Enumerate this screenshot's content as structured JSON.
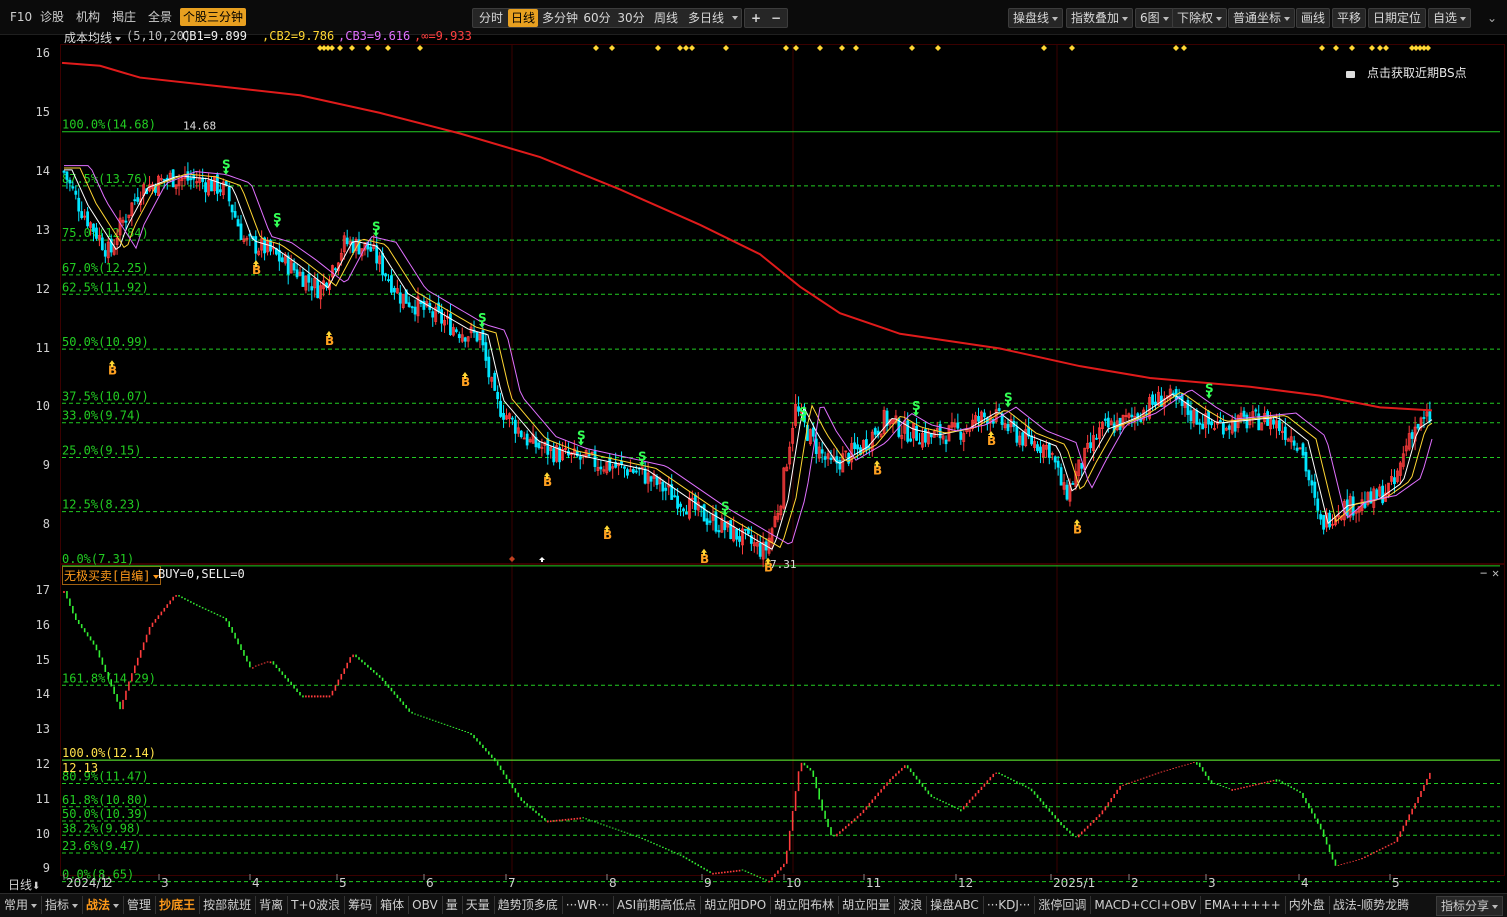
{
  "top_left": [
    {
      "label": "F10"
    },
    {
      "label": "诊股"
    },
    {
      "label": "机构"
    },
    {
      "label": "揭庄"
    },
    {
      "label": "全景"
    },
    {
      "label": "个股三分钟",
      "highlight": true
    }
  ],
  "periods": [
    "分时",
    "日线",
    "多分钟",
    "60分",
    "30分",
    "周线",
    "多日线"
  ],
  "active_period": "日线",
  "zoom_in": "+",
  "zoom_out": "−",
  "right_tools": [
    {
      "label": "操盘线",
      "dd": true
    },
    {
      "label": "指数叠加",
      "dd": true
    },
    {
      "label": "6图",
      "dd": true
    },
    {
      "label": "下除权",
      "dd": true
    },
    {
      "label": "普通坐标",
      "dd": true
    },
    {
      "label": "画线",
      "dd": false
    },
    {
      "label": "平移",
      "dd": false
    },
    {
      "label": "日期定位",
      "dd": false
    },
    {
      "label": "自选",
      "dd": true
    }
  ],
  "main": {
    "indicator_name": "成本均线",
    "params": "(5,10,20)",
    "cb1": "CB1=9.899",
    "cb2": ",CB2=9.786",
    "cb3": ",CB3=9.616",
    "cbinf": ",∞=9.933",
    "y_labels": [
      "16",
      "15",
      "14",
      "13",
      "12",
      "11",
      "10",
      "9",
      "8"
    ],
    "fib_levels": [
      {
        "label": "100.0%(14.68)",
        "value": 14.68,
        "solid": true
      },
      {
        "label": "87.5%(13.76)",
        "value": 13.76
      },
      {
        "label": "75.0%(12.84)",
        "value": 12.84
      },
      {
        "label": "67.0%(12.25)",
        "value": 12.25
      },
      {
        "label": "62.5%(11.92)",
        "value": 11.92
      },
      {
        "label": "50.0%(10.99)",
        "value": 10.99
      },
      {
        "label": "37.5%(10.07)",
        "value": 10.07
      },
      {
        "label": "33.0%(9.74)",
        "value": 9.74
      },
      {
        "label": "25.0%(9.15)",
        "value": 9.15
      },
      {
        "label": "12.5%(8.23)",
        "value": 8.23
      },
      {
        "label": "0.0%(7.31)",
        "value": 7.31,
        "solid": true
      }
    ],
    "high_label": "14.68",
    "low_label": "7.31",
    "bs_notice": "点击获取近期BS点",
    "buy_mark": "B",
    "sell_mark": "S"
  },
  "sub": {
    "indicator": "无极买卖[自编]",
    "values": "BUY=0,SELL=0",
    "y_labels": [
      "17",
      "16",
      "15",
      "14",
      "13",
      "12",
      "11",
      "10",
      "9"
    ],
    "fib_levels": [
      {
        "label": "161.8%(14.29)",
        "value": 14.29
      },
      {
        "label": "100.0%(12.14)",
        "value": 12.14,
        "solid": true
      },
      {
        "label": "80.9%(11.47)",
        "value": 11.47
      },
      {
        "label": "61.8%(10.80)",
        "value": 10.8
      },
      {
        "label": "50.0%(10.39)",
        "value": 10.39
      },
      {
        "label": "38.2%(9.98)",
        "value": 9.98
      },
      {
        "label": "23.6%(9.47)",
        "value": 9.47
      },
      {
        "label": "0.0%(8.65)",
        "value": 8.65
      }
    ],
    "mark_label": "12.13"
  },
  "x_axis": {
    "period_label": "日线",
    "labels": [
      "2024/1",
      "2",
      "3",
      "4",
      "5",
      "6",
      "7",
      "8",
      "9",
      "10",
      "11",
      "12",
      "2025/1",
      "2",
      "3",
      "4",
      "5"
    ]
  },
  "bottom_tabs": [
    {
      "label": "常用",
      "dd": true
    },
    {
      "label": "指标",
      "dd": true
    },
    {
      "label": "战法",
      "dd": true,
      "active": true
    },
    {
      "label": "管理"
    },
    {
      "label": "抄底王",
      "active": true
    },
    {
      "label": "按部就班"
    },
    {
      "label": "背离"
    },
    {
      "label": "T+0波浪"
    },
    {
      "label": "筹码"
    },
    {
      "label": "箱体"
    },
    {
      "label": "OBV"
    },
    {
      "label": "量"
    },
    {
      "label": "天量"
    },
    {
      "label": "趋势顶多底"
    },
    {
      "label": "···WR···"
    },
    {
      "label": "ASI前期高低点"
    },
    {
      "label": "胡立阳DPO"
    },
    {
      "label": "胡立阳布林"
    },
    {
      "label": "胡立阳量"
    },
    {
      "label": "波浪"
    },
    {
      "label": "操盘ABC"
    },
    {
      "label": "···KDJ···"
    },
    {
      "label": "涨停回调"
    },
    {
      "label": "MACD+CCI+OBV"
    },
    {
      "label": "EMA+++++"
    },
    {
      "label": "内外盘"
    },
    {
      "label": "战法-顺势龙腾"
    }
  ],
  "share_button": "指标分享",
  "colors": {
    "up": "#ff3c3c",
    "down": "#00e5ff",
    "cost_line": "#e01b1b",
    "fib": "#22cc22",
    "grid": "#3a0000",
    "accent": "#e8a020"
  }
}
